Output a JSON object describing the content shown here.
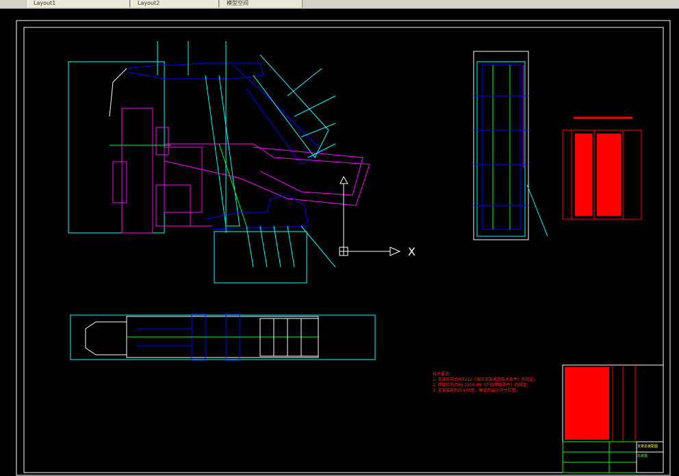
{
  "tabs": [
    {
      "label": "Layout1"
    },
    {
      "label": "Layout2"
    },
    {
      "label": "模型空间"
    }
  ],
  "colors": {
    "background": "#000000",
    "frame": "#ffffff",
    "cyan": "#00ffff",
    "blue": "#0000ff",
    "magenta": "#ff00ff",
    "red": "#ff0000",
    "green": "#00ff00",
    "yellow": "#ffff00"
  },
  "axis_label": "X",
  "technical_notes": {
    "heading": "技术要求：",
    "lines": [
      "1. 支架应符合MT312《液压支架通用技术条件》的规定。",
      "2. 焊接应符合MJ 2200-89《产品焊接零件》的规定。",
      "3. 支架装配后应全检查，确定到最小尺寸位置。"
    ]
  },
  "title_block": {
    "name": "支架总装配图",
    "subtitle": "总装图"
  }
}
